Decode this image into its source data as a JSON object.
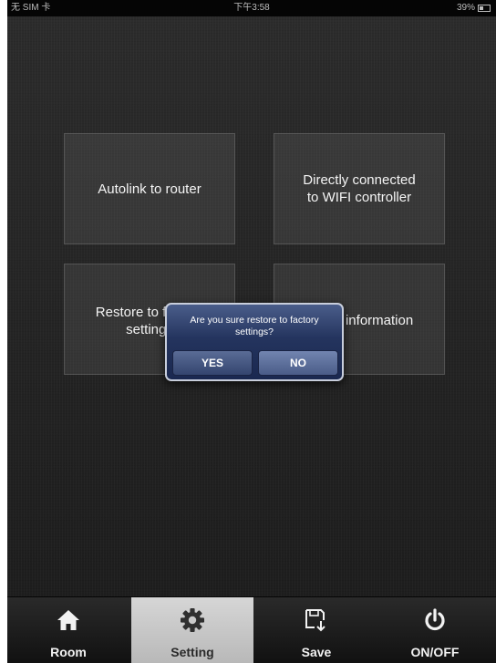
{
  "status_bar": {
    "carrier": "无 SIM 卡",
    "time": "下午3:58",
    "battery": "39%"
  },
  "tiles": {
    "autolink": "Autolink to router",
    "direct": "Directly connected\nto WIFI controller",
    "restore": "Restore to factory\nsettings",
    "room_info": "Room information"
  },
  "dialog": {
    "message": "Are you sure restore to factory settings?",
    "yes_label": "YES",
    "no_label": "NO"
  },
  "tab_bar": {
    "room": "Room",
    "setting": "Setting",
    "save": "Save",
    "onoff": "ON/OFF",
    "selected": "Setting"
  },
  "icons": {
    "room": "home-icon",
    "setting": "gear-icon",
    "save": "save-icon",
    "onoff": "power-icon"
  }
}
